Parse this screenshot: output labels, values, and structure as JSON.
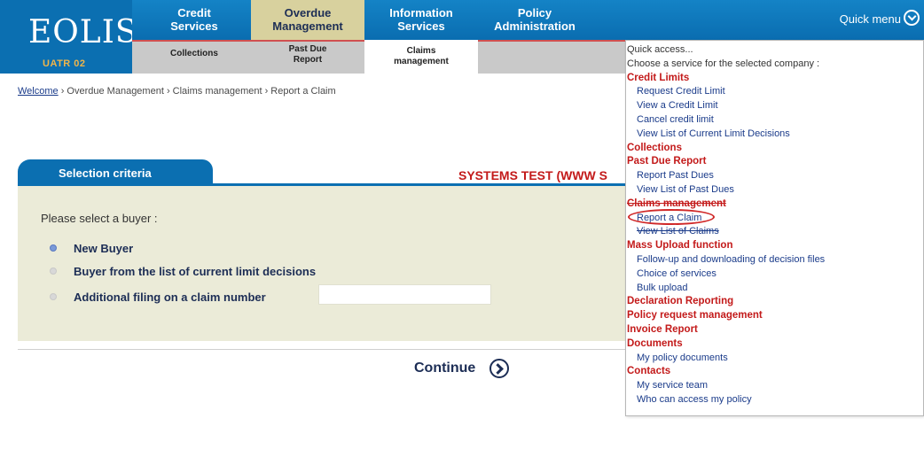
{
  "logo": {
    "text": "EOLIS",
    "sub": "UATR 02"
  },
  "topnav": [
    {
      "label": "Credit\nServices"
    },
    {
      "label": "Overdue\nManagement",
      "active": true
    },
    {
      "label": "Information\nServices"
    },
    {
      "label": "Policy\nAdministration"
    }
  ],
  "quick_menu": {
    "label": "Quick menu"
  },
  "subnav": [
    {
      "label": "Collections"
    },
    {
      "label": "Past Due\nReport"
    },
    {
      "label": "Claims\nmanagement",
      "active": true
    }
  ],
  "breadcrumb": {
    "welcome": "Welcome",
    "rest": " › Overdue Management › Claims management › Report a Claim"
  },
  "banner": "SYSTEMS TEST (WWW S",
  "criteria": {
    "tab": "Selection criteria",
    "prompt": "Please select a buyer :",
    "options": [
      {
        "label": "New Buyer",
        "selected": true
      },
      {
        "label": "Buyer from the list of current limit decisions",
        "selected": false
      },
      {
        "label": "Additional filing on a claim number",
        "selected": false
      }
    ],
    "claim_number_value": ""
  },
  "continue_label": "Continue",
  "quick_access": {
    "lines": [
      {
        "kind": "intro",
        "text": "Quick access..."
      },
      {
        "kind": "intro",
        "text": "Choose a service for the selected company :"
      },
      {
        "kind": "head",
        "text": "Credit Limits"
      },
      {
        "kind": "link",
        "text": "Request Credit Limit"
      },
      {
        "kind": "link",
        "text": "View a Credit Limit"
      },
      {
        "kind": "link",
        "text": "Cancel credit limit"
      },
      {
        "kind": "link",
        "text": "View List of Current Limit Decisions"
      },
      {
        "kind": "head",
        "text": "Collections"
      },
      {
        "kind": "head",
        "text": "Past Due Report"
      },
      {
        "kind": "link",
        "text": "Report Past Dues"
      },
      {
        "kind": "link",
        "text": "View List of Past Dues"
      },
      {
        "kind": "head",
        "text": "Claims management",
        "strike": true
      },
      {
        "kind": "link",
        "text": "Report a Claim",
        "circled": true
      },
      {
        "kind": "link",
        "text": "View List of Claims",
        "strike": true
      },
      {
        "kind": "head",
        "text": "Mass Upload function"
      },
      {
        "kind": "link",
        "text": "Follow-up and downloading of decision files"
      },
      {
        "kind": "link",
        "text": "Choice of services"
      },
      {
        "kind": "link",
        "text": "Bulk upload"
      },
      {
        "kind": "head",
        "text": "Declaration Reporting"
      },
      {
        "kind": "head",
        "text": "Policy request management"
      },
      {
        "kind": "head",
        "text": "Invoice Report"
      },
      {
        "kind": "head",
        "text": "Documents"
      },
      {
        "kind": "link",
        "text": "My policy documents"
      },
      {
        "kind": "head",
        "text": "Contacts"
      },
      {
        "kind": "link",
        "text": "My service team"
      },
      {
        "kind": "link",
        "text": "Who can access my policy"
      }
    ]
  }
}
